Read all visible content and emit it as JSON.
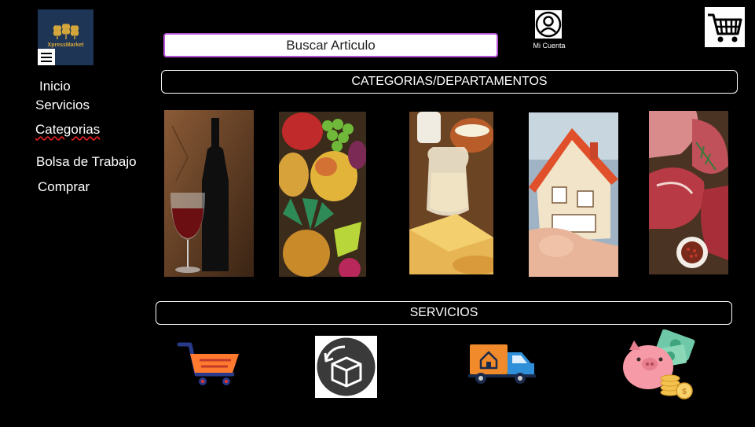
{
  "brand": {
    "logo_text": "XpressMarket"
  },
  "nav": {
    "inicio": "Inicio",
    "servicios": "Servicios",
    "categorias": "Categorias",
    "bolsa": "Bolsa de Trabajo",
    "comprar": "Comprar"
  },
  "search": {
    "placeholder": "Buscar Articulo"
  },
  "account": {
    "label": "Mi Cuenta",
    "icon": "user-circle-icon"
  },
  "cart": {
    "icon": "shopping-cart-icon"
  },
  "categories": {
    "title": "CATEGORIAS/DEPARTAMENTOS",
    "items": [
      "wine",
      "fruits",
      "dairy",
      "real-estate",
      "meat"
    ]
  },
  "services": {
    "title": "SERVICIOS",
    "items": [
      "shopping-cart-icon",
      "package-return-icon",
      "delivery-truck-icon",
      "piggy-bank-savings-icon"
    ]
  },
  "colors": {
    "background": "#000000",
    "search_border": "#b452d8",
    "logo_bg": "#1e3556",
    "logo_gold": "#d4a73c",
    "cart_orange": "#ff7a2f",
    "truck_blue": "#2f8fd8",
    "pig_pink": "#f59aa6"
  }
}
